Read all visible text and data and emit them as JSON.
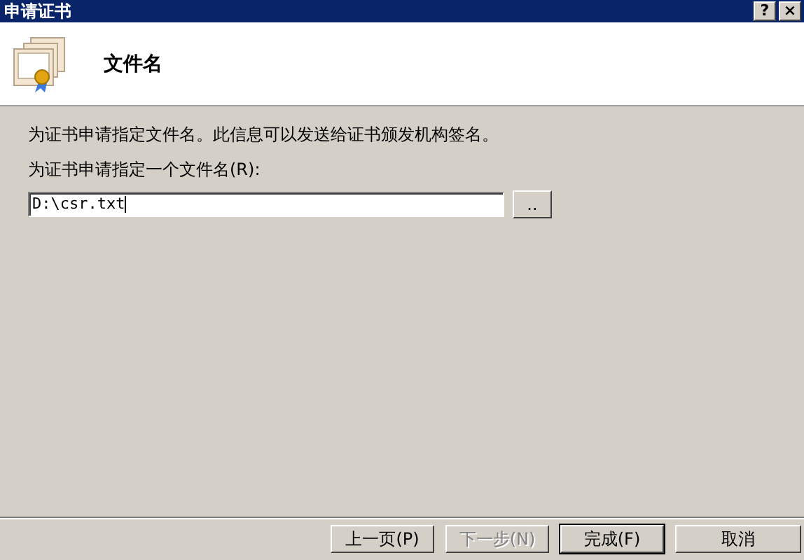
{
  "window": {
    "title": "申请证书",
    "controls": [
      "?",
      "×"
    ]
  },
  "header": {
    "title": "文件名"
  },
  "description": "为证书申请指定文件名。此信息可以发送给证书颁发机构签名。",
  "file_field": {
    "label": "为证书申请指定一个文件名(R):",
    "value": "D:\\csr.txt",
    "browse_label": ".."
  },
  "buttons": [
    {
      "label": "上一页(P)",
      "disabled": false,
      "default": false
    },
    {
      "label": "下一步(N)",
      "disabled": true,
      "default": false
    },
    {
      "label": "完成(F)",
      "disabled": false,
      "default": true
    },
    {
      "label": "取消",
      "disabled": false,
      "default": false
    }
  ]
}
